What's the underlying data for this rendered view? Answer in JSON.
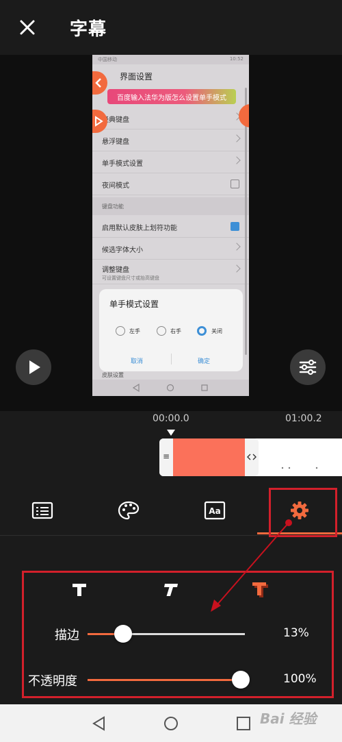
{
  "header": {
    "title": "字幕",
    "close_icon": "close-icon"
  },
  "preview": {
    "status_left": "中国移动",
    "status_right": "10:52",
    "screen_title": "界面设置",
    "banner_text": "百度输入法华为版怎么设置单手模式",
    "items": [
      {
        "label": "经典键盘"
      },
      {
        "label": "悬浮键盘"
      },
      {
        "label": "单手模式设置"
      },
      {
        "label": "夜间模式"
      }
    ],
    "section_label": "键盘功能",
    "items2": [
      {
        "label": "启用默认皮肤上划符功能"
      },
      {
        "label": "候选字体大小"
      },
      {
        "label": "调整键盘",
        "sub": "可设置键盘尺寸或抬高键盘"
      }
    ],
    "dialog": {
      "title": "单手模式设置",
      "options": [
        "左手",
        "右手",
        "关闭"
      ],
      "selected": "关闭",
      "cancel": "取消",
      "confirm": "确定"
    },
    "bottom_label": "皮肤设置"
  },
  "timeline": {
    "start_time": "00:00.0",
    "end_time": "01:00.2"
  },
  "tools": [
    {
      "icon": "subtitle-list-icon"
    },
    {
      "icon": "palette-icon"
    },
    {
      "icon": "font-icon"
    },
    {
      "icon": "gear-icon",
      "active": true
    }
  ],
  "panel": {
    "styles": [
      {
        "icon": "text-bold-icon"
      },
      {
        "icon": "text-italic-icon"
      },
      {
        "icon": "text-shadow-icon",
        "active": true
      }
    ],
    "stroke": {
      "label": "描边",
      "value": 13,
      "value_text": "13%"
    },
    "opacity": {
      "label": "不透明度",
      "value": 100,
      "value_text": "100%"
    }
  },
  "watermark": "Bai 经验",
  "colors": {
    "accent": "#f26a3e",
    "clip": "#fb715a",
    "annotation": "#d3202b",
    "background": "#1b1b1b"
  }
}
